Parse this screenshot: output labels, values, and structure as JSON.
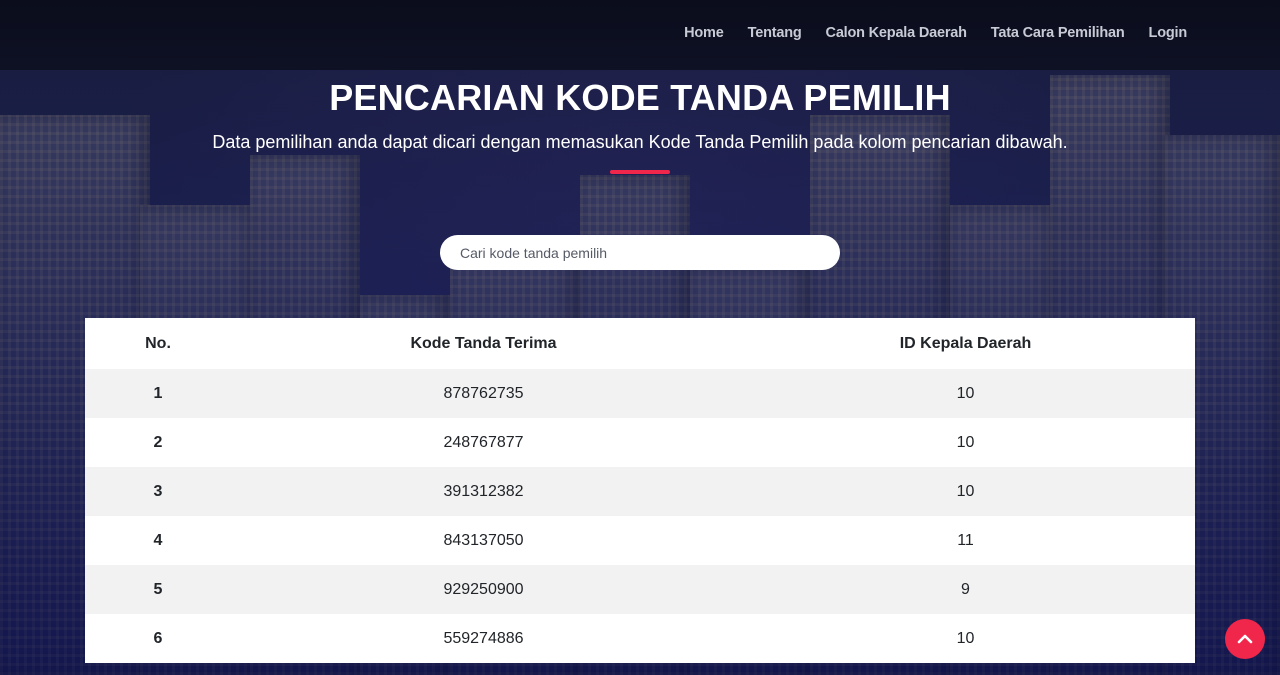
{
  "colors": {
    "accent": "#f0274a",
    "navbar_bg": "#0c0e20",
    "table_stripe": "#f2f2f2"
  },
  "nav": {
    "items": [
      {
        "label": "Home"
      },
      {
        "label": "Tentang"
      },
      {
        "label": "Calon Kepala Daerah"
      },
      {
        "label": "Tata Cara Pemilihan"
      },
      {
        "label": "Login"
      }
    ]
  },
  "hero": {
    "title": "PENCARIAN KODE TANDA PEMILIH",
    "subtitle": "Data pemilihan anda dapat dicari dengan memasukan Kode Tanda Pemilih pada kolom pencarian dibawah."
  },
  "search": {
    "placeholder": "Cari kode tanda pemilih",
    "value": ""
  },
  "table": {
    "headers": [
      "No.",
      "Kode Tanda Terima",
      "ID Kepala Daerah"
    ],
    "rows": [
      {
        "no": "1",
        "kode": "878762735",
        "id": "10"
      },
      {
        "no": "2",
        "kode": "248767877",
        "id": "10"
      },
      {
        "no": "3",
        "kode": "391312382",
        "id": "10"
      },
      {
        "no": "4",
        "kode": "843137050",
        "id": "11"
      },
      {
        "no": "5",
        "kode": "929250900",
        "id": "9"
      },
      {
        "no": "6",
        "kode": "559274886",
        "id": "10"
      }
    ]
  },
  "scroll_top": {
    "icon": "chevron-up-icon"
  }
}
